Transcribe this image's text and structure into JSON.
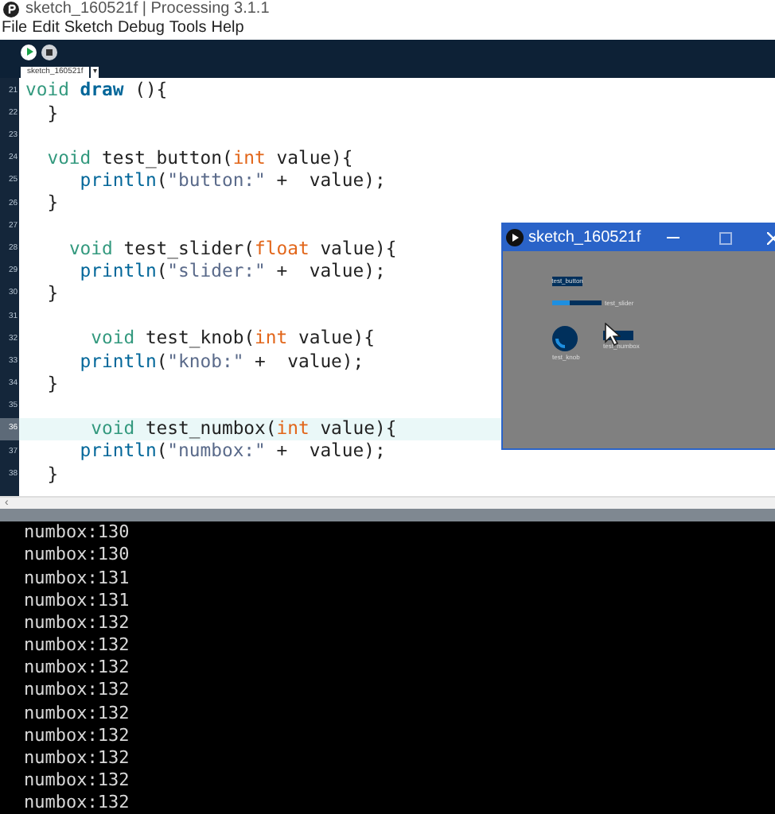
{
  "app": {
    "title": "sketch_160521f | Processing 3.1.1",
    "menu": [
      "File",
      "Edit",
      "Sketch",
      "Debug",
      "Tools",
      "Help"
    ],
    "tabs": [
      {
        "label": "sketch_160521f",
        "selected": true
      }
    ],
    "tab_menu": "▾",
    "scroll_arrow": "‹"
  },
  "editor": {
    "lines": [
      {
        "number": "21",
        "selected": false,
        "code": "void draw (){"
      },
      {
        "number": "22",
        "selected": false,
        "code": "  }"
      },
      {
        "number": "23",
        "selected": false
      },
      {
        "number": "24",
        "selected": false,
        "code": "  void test_button(int value){"
      },
      {
        "number": "25",
        "selected": false,
        "code": "     println(\"button:\" +  value);"
      },
      {
        "number": "26",
        "selected": false,
        "code": "  }"
      },
      {
        "number": "27",
        "selected": false
      },
      {
        "number": "28",
        "selected": false,
        "code": "    void test_slider(float value){"
      },
      {
        "number": "29",
        "selected": false,
        "code": "     println(\"slider:\" +  value);"
      },
      {
        "number": "30",
        "selected": false,
        "code": "  }"
      },
      {
        "number": "31",
        "selected": false
      },
      {
        "number": "32",
        "selected": false,
        "code": "      void test_knob(int value){"
      },
      {
        "number": "33",
        "selected": false,
        "code": "     println(\"knob:\" +  value);"
      },
      {
        "number": "34",
        "selected": false,
        "code": "  }"
      },
      {
        "number": "35",
        "selected": false
      },
      {
        "number": "36",
        "selected": true,
        "code": "      void test_numbox(int value){"
      },
      {
        "number": "37",
        "selected": false,
        "code": "     println(\"numbox:\" +  value);"
      },
      {
        "number": "38",
        "selected": false,
        "code": "  }"
      }
    ]
  },
  "sketch_window": {
    "title": "sketch_160521f",
    "controls": [
      {
        "kind": "button",
        "label": "test_button"
      },
      {
        "kind": "slider",
        "label": "test_slider",
        "level": 0.35
      },
      {
        "kind": "knob",
        "label": "test_knob"
      },
      {
        "kind": "numbox",
        "label": "test_numbox"
      }
    ]
  },
  "console": {
    "lines": [
      "numbox:130",
      "numbox:130",
      "numbox:131",
      "numbox:131",
      "numbox:132",
      "numbox:132",
      "numbox:132",
      "numbox:132",
      "numbox:132",
      "numbox:132",
      "numbox:132",
      "numbox:132",
      "numbox:132"
    ]
  }
}
